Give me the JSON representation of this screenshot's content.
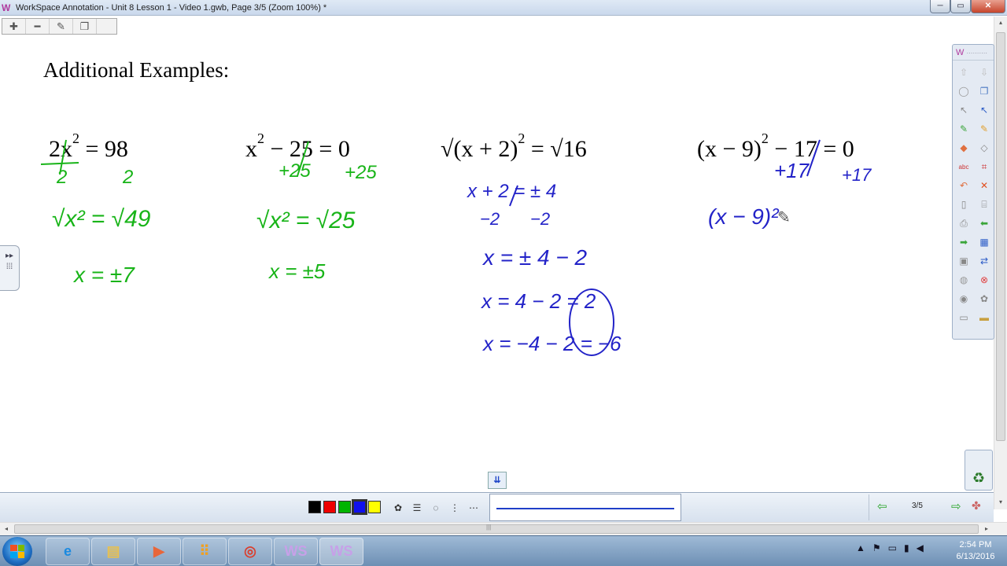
{
  "window": {
    "title": "WorkSpace Annotation - Unit 8 Lesson 1 - Video 1.gwb, Page 3/5  (Zoom 100%) *",
    "app_icon": "W",
    "minimize_label": "─",
    "maximize_label": "▭",
    "close_label": "✕"
  },
  "mini_toolbar": {
    "items": [
      {
        "name": "zoom-in-icon",
        "glyph": "✚"
      },
      {
        "name": "zoom-out-icon",
        "glyph": "━"
      },
      {
        "name": "edit-icon",
        "glyph": "✎"
      },
      {
        "name": "copy-page-icon",
        "glyph": "❐"
      }
    ]
  },
  "canvas": {
    "heading": "Additional Examples:",
    "equations": [
      {
        "lhs": "2x",
        "exp": "2",
        "rhs": "= 98"
      },
      {
        "lhs": "x",
        "exp": "2",
        "rhs": "− 25 = 0"
      },
      {
        "prefix": "√",
        "lhs": "(x + 2)",
        "exp": "2",
        "rhs": "= √16"
      },
      {
        "lhs": "(x − 9)",
        "exp": "2",
        "rhs": "− 17 = 0"
      }
    ],
    "ink_green": {
      "ex1_den1": "2",
      "ex1_den2": "2",
      "ex1_root": "√x² = √49",
      "ex1_result": "x = ±7",
      "ex2_add1": "+25",
      "ex2_add2": "+25",
      "ex2_root": "√x² = √25",
      "ex2_result": "x = ±5"
    },
    "ink_blue": {
      "ex3_line1": "x + 2 = ± 4",
      "ex3_line2a": "−2",
      "ex3_line2b": "−2",
      "ex3_line3": "x = ± 4 − 2",
      "ex3_line4": "x = 4 − 2 = 2",
      "ex3_line5": "x = −4 − 2 = −6",
      "ex4_add1": "+17",
      "ex4_add2": "+17",
      "ex4_line1": "(x − 9)²"
    }
  },
  "tool_panel": {
    "logo": "W",
    "dots": "··········",
    "tools": [
      {
        "name": "arrow-up-icon",
        "glyph": "⇧",
        "color": "#bbbbbb"
      },
      {
        "name": "arrow-down-icon",
        "glyph": "⇩",
        "color": "#bbbbbb"
      },
      {
        "name": "mouse-icon",
        "glyph": "◯",
        "color": "#999999"
      },
      {
        "name": "windows-icon",
        "glyph": "❐",
        "color": "#4a78c2"
      },
      {
        "name": "select-arrow-icon",
        "glyph": "↖",
        "color": "#888888"
      },
      {
        "name": "active-select-icon",
        "glyph": "↖",
        "color": "#2a5bc7"
      },
      {
        "name": "pen-icon",
        "glyph": "✎",
        "color": "#3aa53a"
      },
      {
        "name": "highlighter-icon",
        "glyph": "✎",
        "color": "#e0a030"
      },
      {
        "name": "eraser-icon",
        "glyph": "◆",
        "color": "#e07040"
      },
      {
        "name": "shape-icon",
        "glyph": "◇",
        "color": "#888888"
      },
      {
        "name": "text-icon",
        "glyph": "abc",
        "color": "#cc3333"
      },
      {
        "name": "crop-icon",
        "glyph": "⌗",
        "color": "#cc3333"
      },
      {
        "name": "undo-icon",
        "glyph": "↶",
        "color": "#e07040"
      },
      {
        "name": "delete-icon",
        "glyph": "✕",
        "color": "#e05020"
      },
      {
        "name": "page-icon",
        "glyph": "▯",
        "color": "#888888"
      },
      {
        "name": "page-tools-icon",
        "glyph": "⌸",
        "color": "#888888"
      },
      {
        "name": "print-icon",
        "glyph": "⎙",
        "color": "#888888"
      },
      {
        "name": "back-icon",
        "glyph": "⬅",
        "color": "#3aa53a"
      },
      {
        "name": "forward-icon",
        "glyph": "➡",
        "color": "#3aa53a"
      },
      {
        "name": "grid-icon",
        "glyph": "▦",
        "color": "#2a5bc7"
      },
      {
        "name": "save-icon",
        "glyph": "▣",
        "color": "#888888"
      },
      {
        "name": "swap-icon",
        "glyph": "⇄",
        "color": "#2a5bc7"
      },
      {
        "name": "spotlight-icon",
        "glyph": "◍",
        "color": "#999999"
      },
      {
        "name": "stop-icon",
        "glyph": "⊗",
        "color": "#e04040"
      },
      {
        "name": "camera-icon",
        "glyph": "◉",
        "color": "#888888"
      },
      {
        "name": "palette-icon",
        "glyph": "✿",
        "color": "#888888"
      },
      {
        "name": "screen-icon",
        "glyph": "▭",
        "color": "#888888"
      },
      {
        "name": "folder-icon",
        "glyph": "▬",
        "color": "#c8a040"
      }
    ]
  },
  "side_handle": {
    "glyph_top": "▸▸",
    "glyph_bottom": "⁞⁞⁞"
  },
  "recycle_glyph": "♻",
  "collapse_glyph": "⇊",
  "bottom_bar": {
    "colors": [
      {
        "name": "black-swatch",
        "hex": "#000000"
      },
      {
        "name": "red-swatch",
        "hex": "#ee0000"
      },
      {
        "name": "green-swatch",
        "hex": "#00b400"
      },
      {
        "name": "blue-swatch",
        "hex": "#1010ee"
      },
      {
        "name": "yellow-swatch",
        "hex": "#ffff00"
      }
    ],
    "selected_color": "blue-swatch",
    "tools": [
      {
        "name": "palette-icon",
        "glyph": "✿"
      },
      {
        "name": "line-width-icon",
        "glyph": "☰"
      },
      {
        "name": "transparency-icon",
        "glyph": "◌"
      },
      {
        "name": "line-style-icon",
        "glyph": "⋮"
      },
      {
        "name": "dash-style-icon",
        "glyph": "⋯"
      }
    ],
    "line_color": "#1f3fc8",
    "page_prev": "⇦",
    "page_next": "⇨",
    "page_number": "3/5",
    "extra_glyph": "✤"
  },
  "hscroll": {
    "left": "◂",
    "right": "▸",
    "grip": "|||"
  },
  "vscroll": {
    "up": "▴",
    "down": "▾"
  },
  "taskbar": {
    "buttons": [
      {
        "name": "internet-explorer-icon",
        "glyph": "e",
        "color": "#1b8ae0"
      },
      {
        "name": "file-explorer-icon",
        "glyph": "▤",
        "color": "#e8c050"
      },
      {
        "name": "media-player-icon",
        "glyph": "▶",
        "color": "#e8663a"
      },
      {
        "name": "apps-icon",
        "glyph": "⠿",
        "color": "#f0a020"
      },
      {
        "name": "chrome-icon",
        "glyph": "◎",
        "color": "#d94030"
      },
      {
        "name": "workspace-icon",
        "glyph": "WS",
        "color": "#c7a0e8"
      },
      {
        "name": "workspace-active-icon",
        "glyph": "WS",
        "color": "#c7a0e8"
      }
    ],
    "tray": [
      {
        "name": "tray-expand-icon",
        "glyph": "▲"
      },
      {
        "name": "action-center-icon",
        "glyph": "⚑"
      },
      {
        "name": "display-icon",
        "glyph": "▭"
      },
      {
        "name": "network-icon",
        "glyph": "▮"
      },
      {
        "name": "volume-icon",
        "glyph": "◀"
      }
    ],
    "time": "2:54 PM",
    "date": "6/13/2016"
  }
}
